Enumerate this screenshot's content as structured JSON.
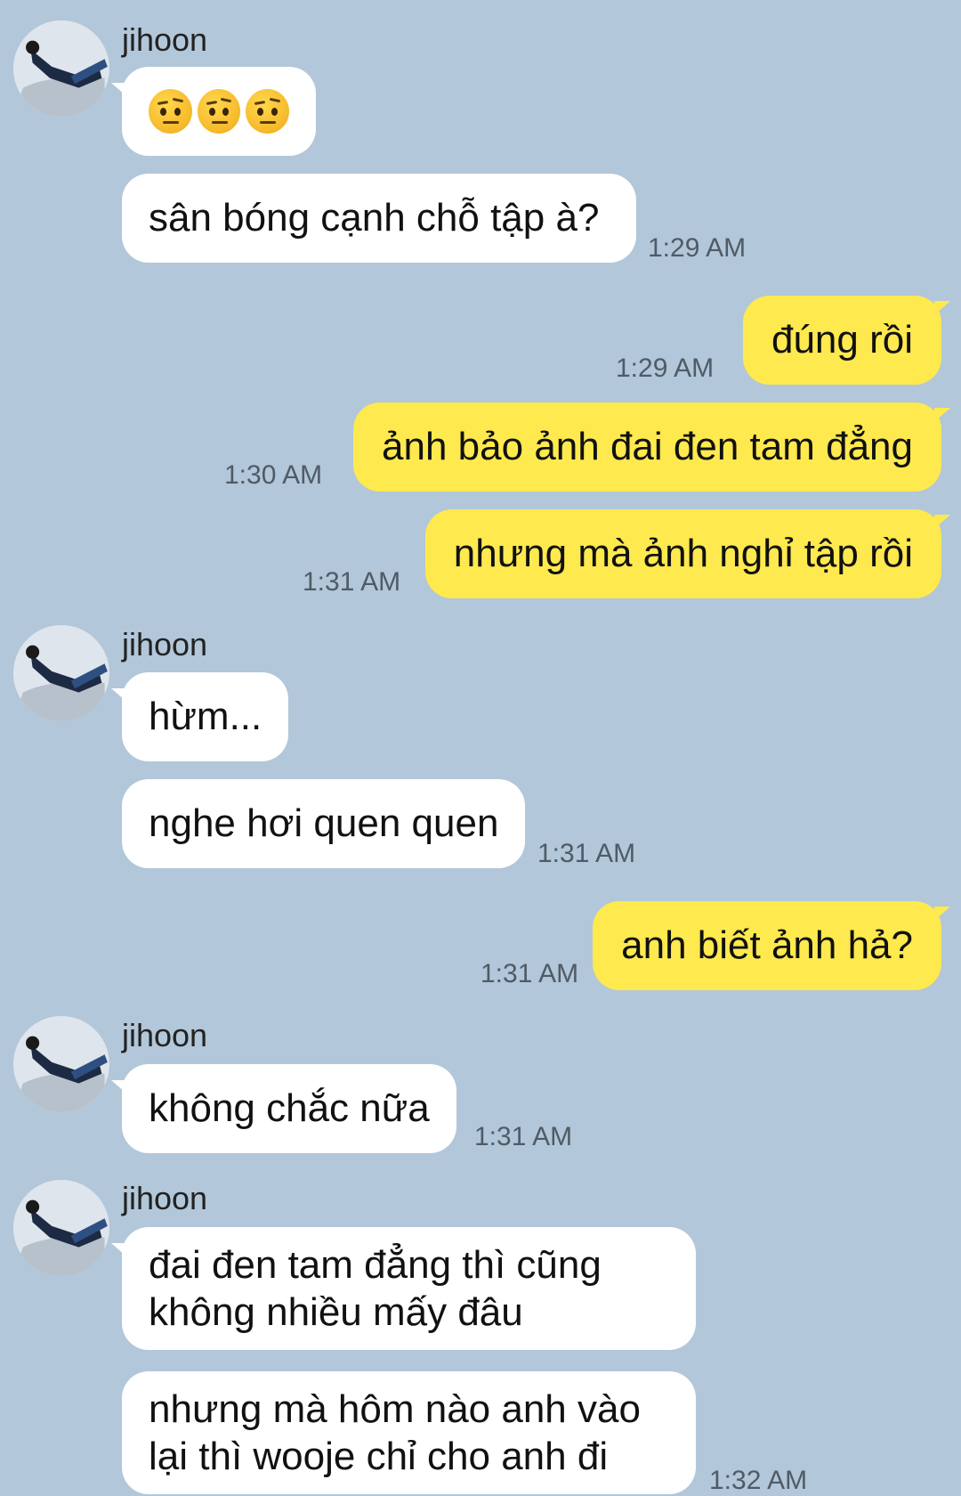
{
  "chat": {
    "background_color": "#b2c7d9",
    "incoming_bubble_color": "#ffffff",
    "outgoing_bubble_color": "#fee94e",
    "messages": [
      {
        "sender": "jihoon",
        "text": "🤨🤨🤨",
        "time": ""
      },
      {
        "sender": "",
        "text": "sân bóng cạnh chỗ tập à?",
        "time": "1:29 AM"
      },
      {
        "sender": "me",
        "text": "đúng rồi",
        "time": "1:29 AM"
      },
      {
        "sender": "me",
        "text": "ảnh bảo ảnh đai đen tam đẳng",
        "time": "1:30 AM"
      },
      {
        "sender": "me",
        "text": "nhưng mà ảnh nghỉ tập rồi",
        "time": "1:31 AM"
      },
      {
        "sender": "jihoon",
        "text": "hừm...",
        "time": ""
      },
      {
        "sender": "",
        "text": "nghe hơi quen quen",
        "time": "1:31 AM"
      },
      {
        "sender": "me",
        "text": "anh biết ảnh hả?",
        "time": "1:31 AM"
      },
      {
        "sender": "jihoon",
        "text": "không chắc nữa",
        "time": "1:31 AM"
      },
      {
        "sender": "jihoon",
        "text": "đai đen tam đẳng thì cũng không nhiều mấy đâu",
        "time": ""
      },
      {
        "sender": "",
        "text": "nhưng mà hôm nào anh vào lại thì wooje chỉ cho anh đi",
        "time": "1:32 AM"
      }
    ]
  }
}
